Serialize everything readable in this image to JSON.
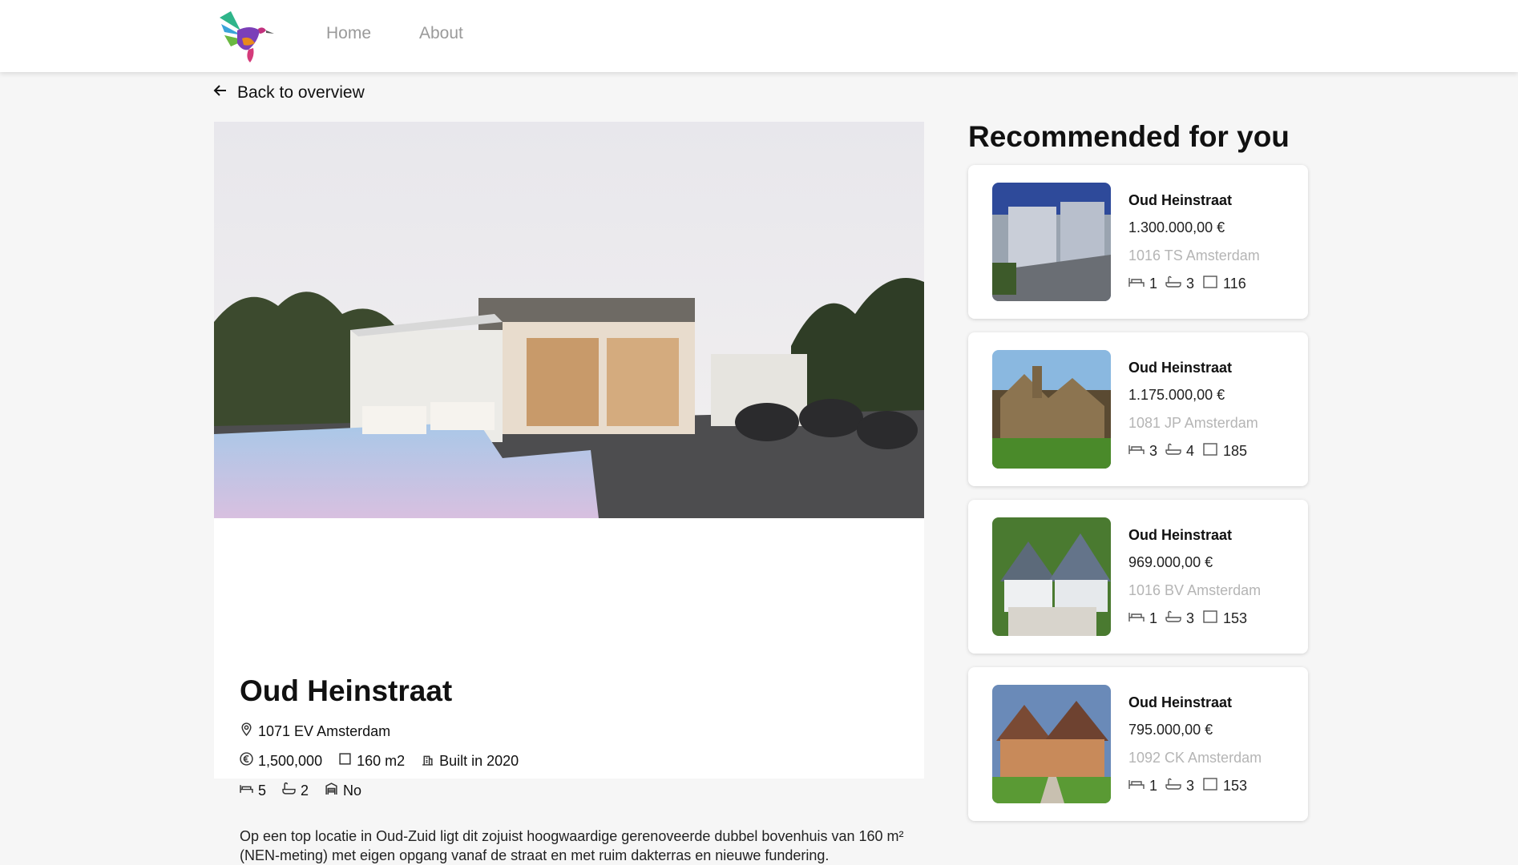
{
  "nav": {
    "home": "Home",
    "about": "About"
  },
  "back_label": "Back to overview",
  "listing": {
    "title": "Oud Heinstraat",
    "address": "1071 EV Amsterdam",
    "price": "1,500,000",
    "size": "160 m2",
    "built": "Built in 2020",
    "bedrooms": "5",
    "bathrooms": "2",
    "garage": "No",
    "description": "Op een top locatie in Oud-Zuid ligt dit zojuist hoogwaardige gerenoveerde dubbel bovenhuis van 160 m² (NEN-meting) met eigen opgang vanaf de straat en met ruim dakterras en nieuwe fundering."
  },
  "recommended": {
    "title": "Recommended for you",
    "items": [
      {
        "name": "Oud Heinstraat",
        "price": "1.300.000,00 €",
        "address": "1016 TS Amsterdam",
        "beds": "1",
        "baths": "3",
        "size": "116"
      },
      {
        "name": "Oud Heinstraat",
        "price": "1.175.000,00 €",
        "address": "1081 JP Amsterdam",
        "beds": "3",
        "baths": "4",
        "size": "185"
      },
      {
        "name": "Oud Heinstraat",
        "price": "969.000,00 €",
        "address": "1016 BV Amsterdam",
        "beds": "1",
        "baths": "3",
        "size": "153"
      },
      {
        "name": "Oud Heinstraat",
        "price": "795.000,00 €",
        "address": "1092 CK Amsterdam",
        "beds": "1",
        "baths": "3",
        "size": "153"
      }
    ]
  },
  "icons": {
    "logo": "hummingbird-logo",
    "back": "arrow-left-icon",
    "location": "map-pin-icon",
    "price": "euro-icon",
    "size": "area-icon",
    "built": "building-icon",
    "bed": "bed-icon",
    "bath": "bath-icon",
    "garage": "garage-icon"
  }
}
